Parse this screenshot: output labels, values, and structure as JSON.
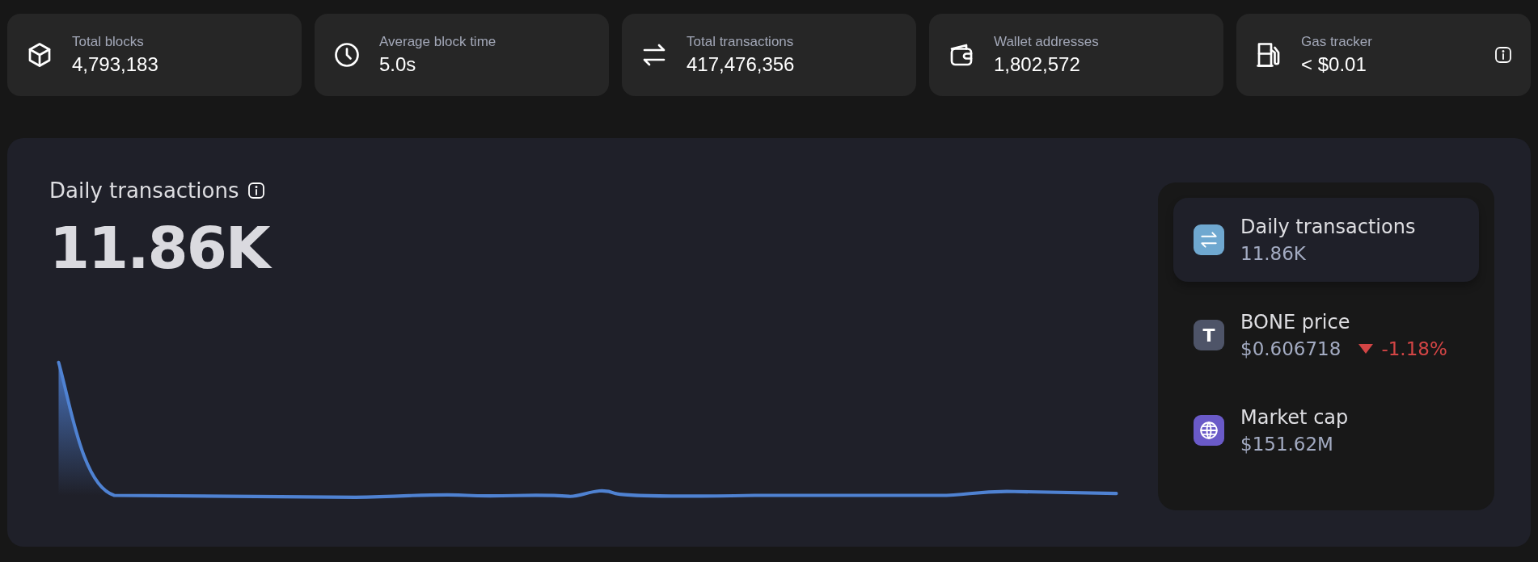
{
  "stats": [
    {
      "label": "Total blocks",
      "value": "4,793,183"
    },
    {
      "label": "Average block time",
      "value": "5.0s"
    },
    {
      "label": "Total transactions",
      "value": "417,476,356"
    },
    {
      "label": "Wallet addresses",
      "value": "1,802,572"
    },
    {
      "label": "Gas tracker",
      "value": "< $0.01",
      "info": true
    }
  ],
  "chart_panel": {
    "title": "Daily transactions",
    "value": "11.86K"
  },
  "metrics": [
    {
      "color": "#6fa8d0",
      "label": "Daily transactions",
      "value": "11.86K",
      "selected": true
    },
    {
      "glyph": "T",
      "color": "#4e5468",
      "label": "BONE price",
      "value": "$0.606718",
      "change": "-1.18%",
      "selected": false
    },
    {
      "color": "#6a5ac8",
      "label": "Market cap",
      "value": "$151.62M",
      "selected": false
    }
  ]
}
